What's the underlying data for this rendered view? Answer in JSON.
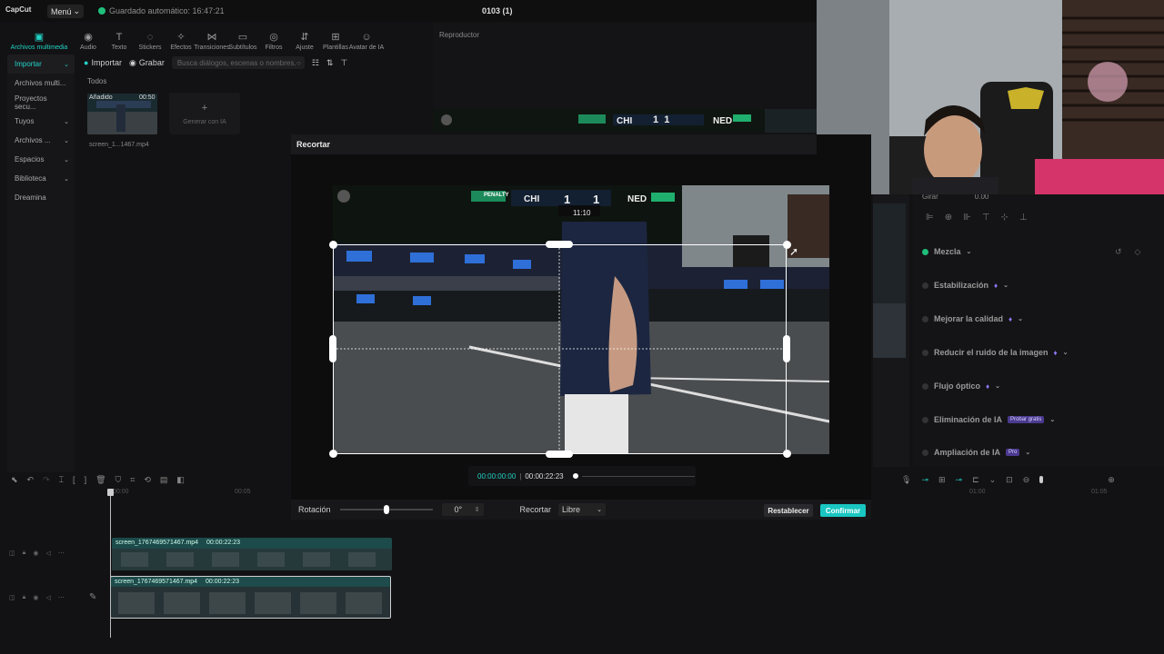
{
  "titlebar": {
    "logo": "CapCut",
    "menu": "Menú",
    "autosave": "Guardado automático: 16:47:21",
    "project": "0103 (1)"
  },
  "toolbar": [
    {
      "label": "Archivos multimedia",
      "icon": "media-icon",
      "glyph": "▣",
      "active": true
    },
    {
      "label": "Audio",
      "icon": "audio-icon",
      "glyph": "◉"
    },
    {
      "label": "Texto",
      "icon": "text-icon",
      "glyph": "T"
    },
    {
      "label": "Stickers",
      "icon": "sticker-icon",
      "glyph": "◌"
    },
    {
      "label": "Efectos",
      "icon": "effects-icon",
      "glyph": "✧"
    },
    {
      "label": "Transiciones",
      "icon": "transitions-icon",
      "glyph": "⋈"
    },
    {
      "label": "Subtítulos",
      "icon": "subtitles-icon",
      "glyph": "▭"
    },
    {
      "label": "Filtros",
      "icon": "filters-icon",
      "glyph": "◎"
    },
    {
      "label": "Ajuste",
      "icon": "adjust-icon",
      "glyph": "⇵"
    },
    {
      "label": "Plantillas",
      "icon": "templates-icon",
      "glyph": "⊞"
    },
    {
      "label": "Avatar de IA",
      "icon": "avatar-icon",
      "glyph": "☺"
    }
  ],
  "sidebar": {
    "items": [
      {
        "label": "Importar",
        "active": true
      },
      {
        "label": "Archivos multi..."
      },
      {
        "label": "Proyectos secu..."
      },
      {
        "label": "Tuyos"
      },
      {
        "label": "Archivos ..."
      },
      {
        "label": "Espacios"
      },
      {
        "label": "Biblioteca"
      },
      {
        "label": "Dreamina"
      }
    ]
  },
  "media": {
    "import": "Importar",
    "record": "Grabar",
    "search_placeholder": "Busca diálogos, escenas o nombres...",
    "all": "Todos",
    "thumb_label": "Añadido",
    "thumb_duration": "00:50",
    "thumb_name": "screen_1...1467.mp4",
    "generate_ai": "Generar con IA"
  },
  "player": {
    "label": "Reproductor",
    "score_left": "CHI",
    "score": "1  1",
    "score_right": "NED"
  },
  "right_panel": {
    "rotate_label": "Girar",
    "rotate_value": "0.00",
    "items": [
      {
        "label": "Mezcla",
        "on": true
      },
      {
        "label": "Estabilización"
      },
      {
        "label": "Mejorar la calidad"
      },
      {
        "label": "Reducir el ruido de la imagen"
      },
      {
        "label": "Flujo óptico"
      },
      {
        "label": "Eliminación de IA",
        "badge": "Probar gratis"
      },
      {
        "label": "Ampliación de IA",
        "badge": "Pro"
      }
    ]
  },
  "dialog": {
    "title": "Recortar",
    "scoreboard": {
      "penalty": "PENALTY",
      "left": "CHI",
      "score_a": "1",
      "score_b": "1",
      "right": "NED",
      "clock": "11:10"
    },
    "time_current": "00:00:00:00",
    "time_total": "00:00:22:23",
    "rotation_label": "Rotación",
    "rotation_value": "0°",
    "crop_label": "Recortar",
    "crop_mode": "Libre",
    "reset": "Restablecer",
    "confirm": "Confirmar"
  },
  "timeline": {
    "ruler_marks": [
      "00:00",
      "00:05",
      "01:00",
      "01:05"
    ],
    "clips": [
      {
        "name": "screen_1767469571467.mp4",
        "duration": "00:00:22:23"
      },
      {
        "name": "screen_1767469571467.mp4",
        "duration": "00:00:22:23"
      }
    ]
  },
  "colors": {
    "accent": "#22d3c5",
    "confirm": "#19c6c1",
    "clip": "#1e4b4b"
  }
}
